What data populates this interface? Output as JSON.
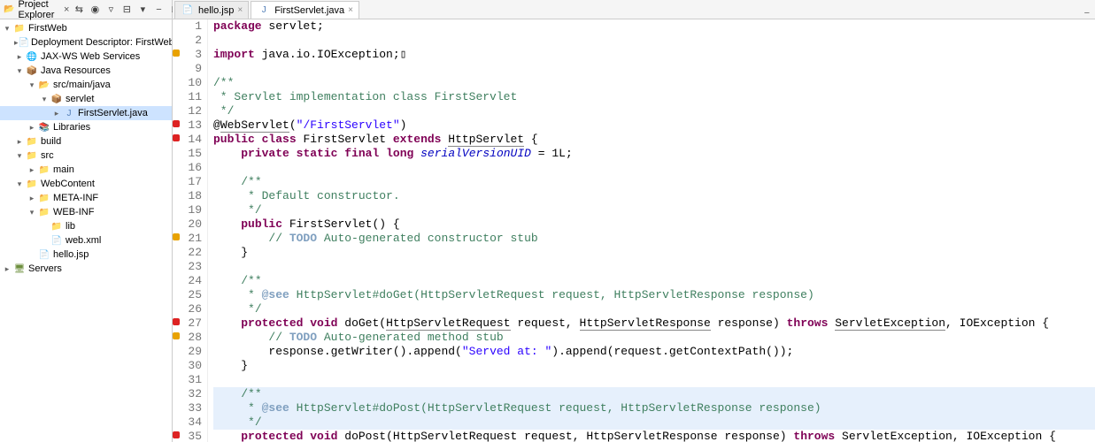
{
  "explorer": {
    "title": "Project Explorer",
    "toolbar_icons": [
      "link-icon",
      "focus-icon",
      "filter-icon",
      "collapse-icon",
      "menu-icon",
      "min-icon",
      "max-icon"
    ]
  },
  "tree": [
    {
      "indent": 0,
      "exp": "▾",
      "icon": "folder-icon",
      "glyph": "📁",
      "label": "FirstWeb"
    },
    {
      "indent": 1,
      "exp": "▸",
      "icon": "file-icon",
      "glyph": "📄",
      "label": "Deployment Descriptor:  FirstWeb"
    },
    {
      "indent": 1,
      "exp": "▸",
      "icon": "web-icon",
      "glyph": "🌐",
      "label": "JAX-WS Web Services"
    },
    {
      "indent": 1,
      "exp": "▾",
      "icon": "java-icon",
      "glyph": "📦",
      "label": "Java Resources"
    },
    {
      "indent": 2,
      "exp": "▾",
      "icon": "pkg-icon",
      "glyph": "📂",
      "label": "src/main/java"
    },
    {
      "indent": 3,
      "exp": "▾",
      "icon": "pkg-icon",
      "glyph": "📦",
      "label": "servlet"
    },
    {
      "indent": 4,
      "exp": "▸",
      "icon": "java-icon",
      "glyph": "J",
      "label": "FirstServlet.java",
      "selected": true
    },
    {
      "indent": 2,
      "exp": "▸",
      "icon": "lib-icon",
      "glyph": "📚",
      "label": "Libraries"
    },
    {
      "indent": 1,
      "exp": "▸",
      "icon": "folder-icon",
      "glyph": "📁",
      "label": "build"
    },
    {
      "indent": 1,
      "exp": "▾",
      "icon": "folder-icon",
      "glyph": "📁",
      "label": "src"
    },
    {
      "indent": 2,
      "exp": "▸",
      "icon": "folder-icon",
      "glyph": "📁",
      "label": "main"
    },
    {
      "indent": 1,
      "exp": "▾",
      "icon": "folder-icon",
      "glyph": "📁",
      "label": "WebContent"
    },
    {
      "indent": 2,
      "exp": "▸",
      "icon": "folder-icon",
      "glyph": "📁",
      "label": "META-INF"
    },
    {
      "indent": 2,
      "exp": "▾",
      "icon": "folder-icon",
      "glyph": "📁",
      "label": "WEB-INF"
    },
    {
      "indent": 3,
      "exp": "",
      "icon": "folder-icon",
      "glyph": "📁",
      "label": "lib"
    },
    {
      "indent": 3,
      "exp": "",
      "icon": "xml-icon",
      "glyph": "📄",
      "label": "web.xml"
    },
    {
      "indent": 2,
      "exp": "",
      "icon": "jsp-icon",
      "glyph": "📄",
      "label": "hello.jsp"
    },
    {
      "indent": 0,
      "exp": "▸",
      "icon": "srv-icon",
      "glyph": "🖥",
      "label": "Servers"
    }
  ],
  "tabs": [
    {
      "icon": "jsp-icon",
      "glyph": "📄",
      "label": "hello.jsp",
      "active": false
    },
    {
      "icon": "java-icon",
      "glyph": "J",
      "label": "FirstServlet.java",
      "active": true
    }
  ],
  "code": [
    {
      "n": 1,
      "m": "",
      "hl": false,
      "html": "<span class='kw'>package</span> servlet;"
    },
    {
      "n": 2,
      "m": "",
      "hl": false,
      "html": ""
    },
    {
      "n": 3,
      "m": "warn",
      "hl": false,
      "html": "<span class='kw'>import</span> java.io.IOException;▯"
    },
    {
      "n": 9,
      "m": "",
      "hl": false,
      "html": ""
    },
    {
      "n": 10,
      "m": "",
      "hl": false,
      "html": "<span class='cm'>/**</span>"
    },
    {
      "n": 11,
      "m": "",
      "hl": false,
      "html": "<span class='cm'> * Servlet implementation class FirstServlet</span>"
    },
    {
      "n": 12,
      "m": "",
      "hl": false,
      "html": "<span class='cm'> */</span>"
    },
    {
      "n": 13,
      "m": "error",
      "hl": false,
      "html": "@<span class='link'>WebServlet</span>(<span class='str'>\"/FirstServlet\"</span>)"
    },
    {
      "n": 14,
      "m": "error",
      "hl": false,
      "html": "<span class='kw'>public</span> <span class='kw'>class</span> FirstServlet <span class='kw'>extends</span> <span class='link'>HttpServlet</span> {"
    },
    {
      "n": 15,
      "m": "",
      "hl": false,
      "html": "    <span class='kw'>private</span> <span class='kw'>static</span> <span class='kw'>final</span> <span class='kw'>long</span> <span class='it'>serialVersionUID</span> = 1L;"
    },
    {
      "n": 16,
      "m": "",
      "hl": false,
      "html": ""
    },
    {
      "n": 17,
      "m": "",
      "hl": false,
      "html": "    <span class='cm'>/**</span>"
    },
    {
      "n": 18,
      "m": "",
      "hl": false,
      "html": "    <span class='cm'> * Default constructor.</span>"
    },
    {
      "n": 19,
      "m": "",
      "hl": false,
      "html": "    <span class='cm'> */</span>"
    },
    {
      "n": 20,
      "m": "",
      "hl": false,
      "html": "    <span class='kw'>public</span> FirstServlet() {"
    },
    {
      "n": 21,
      "m": "warn",
      "hl": false,
      "html": "        <span class='cm'>// </span><span class='todo'>TODO</span><span class='cm'> Auto-generated constructor stub</span>"
    },
    {
      "n": 22,
      "m": "",
      "hl": false,
      "html": "    }"
    },
    {
      "n": 23,
      "m": "",
      "hl": false,
      "html": ""
    },
    {
      "n": 24,
      "m": "",
      "hl": false,
      "html": "    <span class='cm'>/**</span>"
    },
    {
      "n": 25,
      "m": "",
      "hl": false,
      "html": "    <span class='cm'> * </span><span class='cmtag'>@see</span><span class='cm'> HttpServlet#doGet(HttpServletRequest request, HttpServletResponse response)</span>"
    },
    {
      "n": 26,
      "m": "",
      "hl": false,
      "html": "    <span class='cm'> */</span>"
    },
    {
      "n": 27,
      "m": "error",
      "hl": false,
      "html": "    <span class='kw'>protected</span> <span class='kw'>void</span> doGet(<span class='link'>HttpServletRequest</span> request, <span class='link'>HttpServletResponse</span> response) <span class='kw'>throws</span> <span class='link'>ServletException</span>, IOException {"
    },
    {
      "n": 28,
      "m": "warn",
      "hl": false,
      "html": "        <span class='cm'>// </span><span class='todo'>TODO</span><span class='cm'> Auto-generated method stub</span>"
    },
    {
      "n": 29,
      "m": "",
      "hl": false,
      "html": "        response.getWriter().append(<span class='str'>\"Served at: \"</span>).append(request.getContextPath());"
    },
    {
      "n": 30,
      "m": "",
      "hl": false,
      "html": "    }"
    },
    {
      "n": 31,
      "m": "",
      "hl": false,
      "html": ""
    },
    {
      "n": 32,
      "m": "",
      "hl": true,
      "html": "    <span class='cm'>/**</span>"
    },
    {
      "n": 33,
      "m": "",
      "hl": true,
      "html": "    <span class='cm'> * </span><span class='cmtag'>@see</span><span class='cm'> HttpServlet#doPost(HttpServletRequest request, HttpServletResponse response)</span>"
    },
    {
      "n": 34,
      "m": "",
      "hl": true,
      "html": "    <span class='cm'> */</span>"
    },
    {
      "n": 35,
      "m": "error",
      "hl": false,
      "html": "    <span class='kw'>protected</span> <span class='kw'>void</span> doPost(<span class='link'>HttpServletRequest</span> request, <span class='link'>HttpServletResponse</span> response) <span class='kw'>throws</span> <span class='link'>ServletException</span>, IOException {"
    }
  ],
  "watermark": ""
}
